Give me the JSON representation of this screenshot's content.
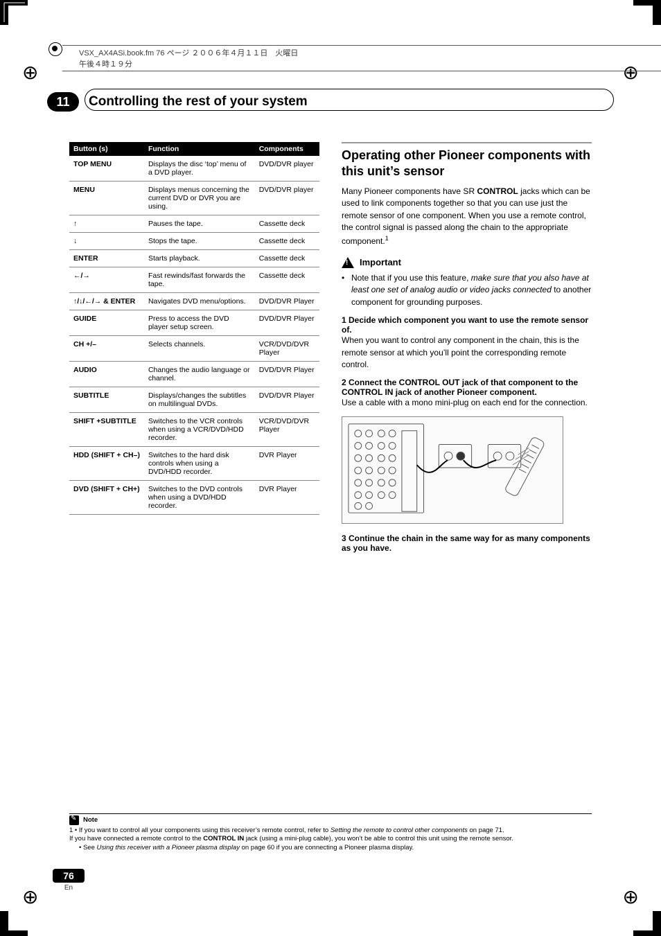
{
  "register": {
    "target": "⊕",
    "header_text": "VSX_AX4ASi.book.fm  76 ページ  ２００６年４月１１日　火曜日　午後４時１９分"
  },
  "chapter": {
    "number": "11",
    "title": "Controlling the rest of your system"
  },
  "table": {
    "headers": [
      "Button (s)",
      "Function",
      "Components"
    ],
    "rows": [
      {
        "b": "TOP MENU",
        "f": "Displays the disc ‘top’ menu of a DVD player.",
        "c": "DVD/DVR player"
      },
      {
        "b": "MENU",
        "f": "Displays menus concerning the current DVD or DVR you are using.",
        "c": "DVD/DVR player"
      },
      {
        "b": "↑",
        "f": "Pauses the tape.",
        "c": "Cassette deck"
      },
      {
        "b": "↓",
        "f": "Stops the tape.",
        "c": "Cassette deck"
      },
      {
        "b": "ENTER",
        "f": "Starts playback.",
        "c": "Cassette deck"
      },
      {
        "b": "←/→",
        "f": "Fast rewinds/fast forwards the tape.",
        "c": "Cassette deck"
      },
      {
        "b": "↑/↓/←/→ & ENTER",
        "f": "Navigates DVD menu/options.",
        "c": "DVD/DVR Player"
      },
      {
        "b": "GUIDE",
        "f": "Press to access the DVD player setup screen.",
        "c": "DVD/DVR Player"
      },
      {
        "b": "CH +/–",
        "f": "Selects channels.",
        "c": "VCR/DVD/DVR Player"
      },
      {
        "b": "AUDIO",
        "f": "Changes the audio language or channel.",
        "c": "DVD/DVR Player"
      },
      {
        "b": "SUBTITLE",
        "f": "Displays/changes the subtitles on multilingual DVDs.",
        "c": "DVD/DVR Player"
      },
      {
        "b": "SHIFT +SUBTITLE",
        "f": "Switches to the VCR controls when using a VCR/DVD/HDD recorder.",
        "c": "VCR/DVD/DVR Player"
      },
      {
        "b": "HDD (SHIFT + CH–)",
        "f": "Switches to the hard disk controls when using a DVD/HDD recorder.",
        "c": "DVR Player"
      },
      {
        "b": "DVD (SHIFT + CH+)",
        "f": "Switches to the DVD controls when using a DVD/HDD recorder.",
        "c": "DVR Player"
      }
    ]
  },
  "right": {
    "heading": "Operating other Pioneer components with this unit’s sensor",
    "intro_a": "Many Pioneer components have SR ",
    "intro_bold": "CONTROL",
    "intro_b": " jacks which can be used to link components together so that you can use just the remote sensor of one component. When you use a remote control, the control signal is passed along the chain to the appropriate component.",
    "sup": "1",
    "important_label": "Important",
    "important_bullet_a": "Note that if you use this feature, ",
    "important_bullet_i": "make sure that you also have at least one set of analog audio or video jacks connected",
    "important_bullet_b": " to another component for grounding purposes.",
    "step1_head": "1    Decide which component you want to use the remote sensor of.",
    "step1_body": "When you want to control any component in the chain, this is the remote sensor at which you’ll point the corresponding remote control.",
    "step2_head": "2    Connect the CONTROL OUT jack of that component to the CONTROL IN jack of another Pioneer component.",
    "step2_body": "Use a cable with a mono mini-plug on each end for the connection.",
    "step3_head": "3    Continue the chain in the same way for as many components as you have."
  },
  "note": {
    "label": "Note",
    "l1a": "1 • If you want to control all your components using this receiver’s remote control, refer to ",
    "l1i": "Setting the remote to control other components",
    "l1b": " on page 71.",
    "l2a": "If you have connected a remote control to the ",
    "l2bold": "CONTROL IN",
    "l2b": " jack (using a mini-plug cable), you won’t be able to control this unit using the remote sensor.",
    "l3a": "• See ",
    "l3i": "Using this receiver with a Pioneer plasma display",
    "l3b": " on page 60 if you are connecting a Pioneer plasma display."
  },
  "page": {
    "num": "76",
    "lang": "En"
  }
}
